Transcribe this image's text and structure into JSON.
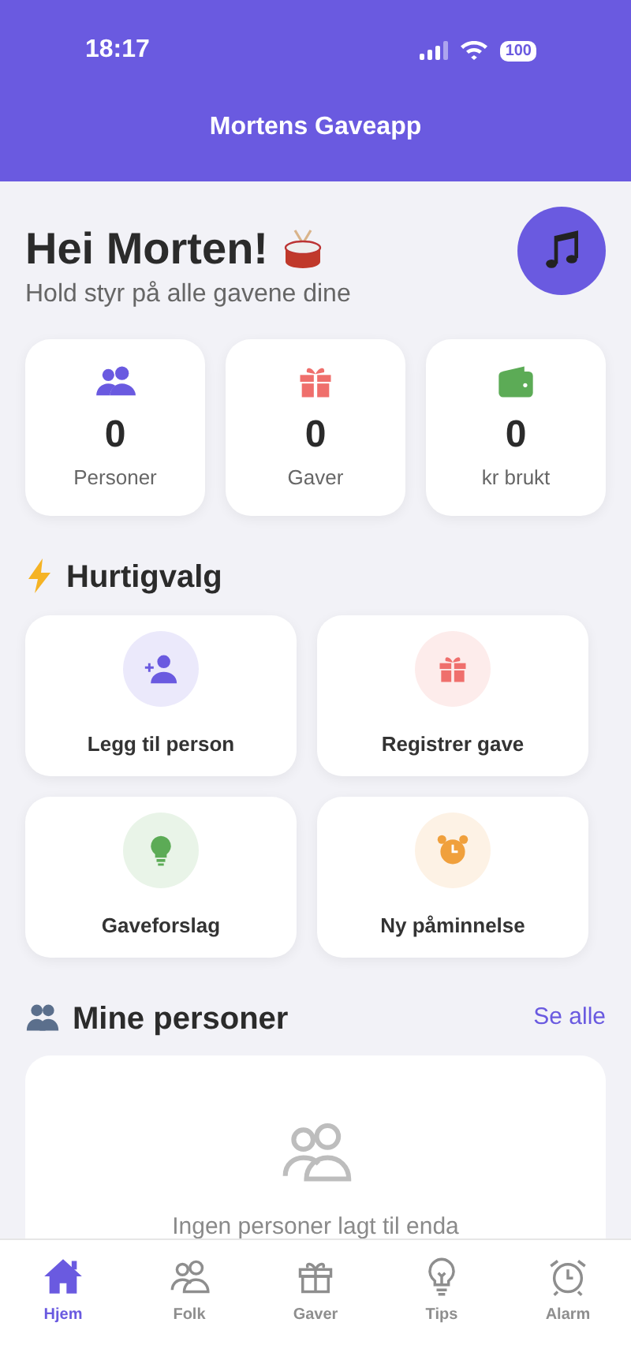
{
  "status_bar": {
    "time": "18:17",
    "battery": "100"
  },
  "header": {
    "title": "Mortens Gaveapp"
  },
  "greeting": {
    "title": "Hei Morten!",
    "subtitle": "Hold styr på alle gavene dine"
  },
  "stats": [
    {
      "kind": "people",
      "value": "0",
      "label": "Personer",
      "color": "#6a5ae0"
    },
    {
      "kind": "gift",
      "value": "0",
      "label": "Gaver",
      "color": "#ef6f6c"
    },
    {
      "kind": "wallet",
      "value": "0",
      "label": "kr brukt",
      "color": "#5cab56"
    }
  ],
  "quick_actions": {
    "title": "Hurtigvalg",
    "items": [
      {
        "kind": "add-person",
        "label": "Legg til person",
        "color": "#6a5ae0"
      },
      {
        "kind": "gift",
        "label": "Registrer gave",
        "color": "#ef6f6c"
      },
      {
        "kind": "bulb",
        "label": "Gaveforslag",
        "color": "#5cab56"
      },
      {
        "kind": "alarm",
        "label": "Ny påminnelse",
        "color": "#f0a03c"
      }
    ]
  },
  "people_section": {
    "title": "Mine personer",
    "link": "Se alle",
    "empty_text": "Ingen personer lagt til enda"
  },
  "tabs": [
    {
      "kind": "home",
      "label": "Hjem",
      "selected": true
    },
    {
      "kind": "people",
      "label": "Folk",
      "selected": false
    },
    {
      "kind": "gift",
      "label": "Gaver",
      "selected": false
    },
    {
      "kind": "bulb",
      "label": "Tips",
      "selected": false
    },
    {
      "kind": "alarm",
      "label": "Alarm",
      "selected": false
    }
  ]
}
